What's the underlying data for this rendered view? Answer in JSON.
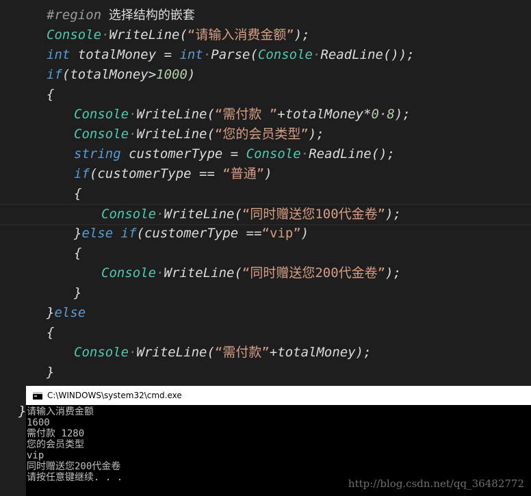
{
  "editor": {
    "lines": [
      [
        [
          "region",
          "#region"
        ],
        [
          "region-text",
          " 选择结构的嵌套"
        ]
      ],
      [
        [
          "type",
          "Console"
        ],
        [
          "dot",
          "·"
        ],
        [
          "plain",
          "WriteLine("
        ],
        [
          "str",
          "“请输入消费金额”"
        ],
        [
          "plain",
          ");"
        ]
      ],
      [
        [
          "kw",
          "int"
        ],
        [
          "plain",
          " totalMoney = "
        ],
        [
          "kw",
          "int"
        ],
        [
          "dot",
          "·"
        ],
        [
          "plain",
          "Parse("
        ],
        [
          "type",
          "Console"
        ],
        [
          "dot",
          "·"
        ],
        [
          "plain",
          "ReadLine());"
        ]
      ],
      [
        [
          "kw",
          "if"
        ],
        [
          "plain",
          "(totalMoney>"
        ],
        [
          "num",
          "1000"
        ],
        [
          "plain",
          ")"
        ]
      ],
      [
        [
          "plain",
          "{"
        ]
      ],
      [
        [
          "type",
          "Console"
        ],
        [
          "dot",
          "·"
        ],
        [
          "plain",
          "WriteLine("
        ],
        [
          "str",
          "“需付款 ”"
        ],
        [
          "plain",
          "+totalMoney*"
        ],
        [
          "num",
          "0·8"
        ],
        [
          "plain",
          ");"
        ]
      ],
      [
        [
          "type",
          "Console"
        ],
        [
          "dot",
          "·"
        ],
        [
          "plain",
          "WriteLine("
        ],
        [
          "str",
          "“您的会员类型”"
        ],
        [
          "plain",
          ");"
        ]
      ],
      [
        [
          "kw",
          "string"
        ],
        [
          "plain",
          " customerType = "
        ],
        [
          "type",
          "Console"
        ],
        [
          "dot",
          "·"
        ],
        [
          "plain",
          "ReadLine();"
        ]
      ],
      [
        [
          "kw",
          "if"
        ],
        [
          "plain",
          "(customerType == "
        ],
        [
          "str",
          "“普通”"
        ],
        [
          "plain",
          ")"
        ]
      ],
      [
        [
          "plain",
          "{"
        ]
      ],
      [
        [
          "type",
          "Console"
        ],
        [
          "dot",
          "·"
        ],
        [
          "plain",
          "WriteLine("
        ],
        [
          "str",
          "“同时赠送您100代金卷”"
        ],
        [
          "plain",
          ");"
        ]
      ],
      [
        [
          "plain",
          "}"
        ],
        [
          "kw",
          "else if"
        ],
        [
          "plain",
          "(customerType =="
        ],
        [
          "str",
          "“vip”"
        ],
        [
          "plain",
          ")"
        ]
      ],
      [
        [
          "plain",
          "{"
        ]
      ],
      [
        [
          "type",
          "Console"
        ],
        [
          "dot",
          "·"
        ],
        [
          "plain",
          "WriteLine("
        ],
        [
          "str",
          "“同时赠送您200代金卷”"
        ],
        [
          "plain",
          ");"
        ]
      ],
      [
        [
          "plain",
          "}"
        ]
      ],
      [
        [
          "plain",
          "}"
        ],
        [
          "kw",
          "else"
        ]
      ],
      [
        [
          "plain",
          "{"
        ]
      ],
      [
        [
          "type",
          "Console"
        ],
        [
          "dot",
          "·"
        ],
        [
          "plain",
          "WriteLine("
        ],
        [
          "str",
          "“需付款”"
        ],
        [
          "plain",
          "+totalMoney);"
        ]
      ],
      [
        [
          "plain",
          "}"
        ]
      ]
    ],
    "overflow_brace": "}"
  },
  "cmd": {
    "title": "C:\\WINDOWS\\system32\\cmd.exe",
    "lines": [
      "请输入消费金额",
      "1600",
      "需付款 1280",
      "您的会员类型",
      "vip",
      "同时赠送您200代金卷",
      "请按任意键继续. . ."
    ]
  },
  "watermark": "http://blog.csdn.net/qq_36482772"
}
